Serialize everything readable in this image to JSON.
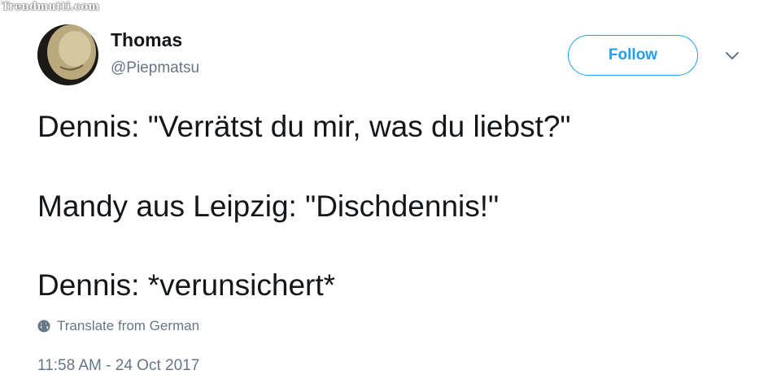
{
  "watermark": "Trendmutti.com",
  "author": {
    "name": "Thomas",
    "handle": "@Piepmatsu"
  },
  "follow_label": "Follow",
  "tweet": {
    "lines": [
      "Dennis: \"Verrätst du mir, was du liebst?\"",
      "Mandy aus Leipzig: \"Dischdennis!\"",
      "Dennis: *verunsichert*"
    ]
  },
  "translate_label": "Translate from German",
  "timestamp": "11:58 AM - 24 Oct 2017",
  "colors": {
    "accent": "#1da1f2",
    "text": "#14171a",
    "secondary": "#657786"
  },
  "icons": {
    "menu": "chevron-down-icon",
    "translate": "globe-icon"
  }
}
